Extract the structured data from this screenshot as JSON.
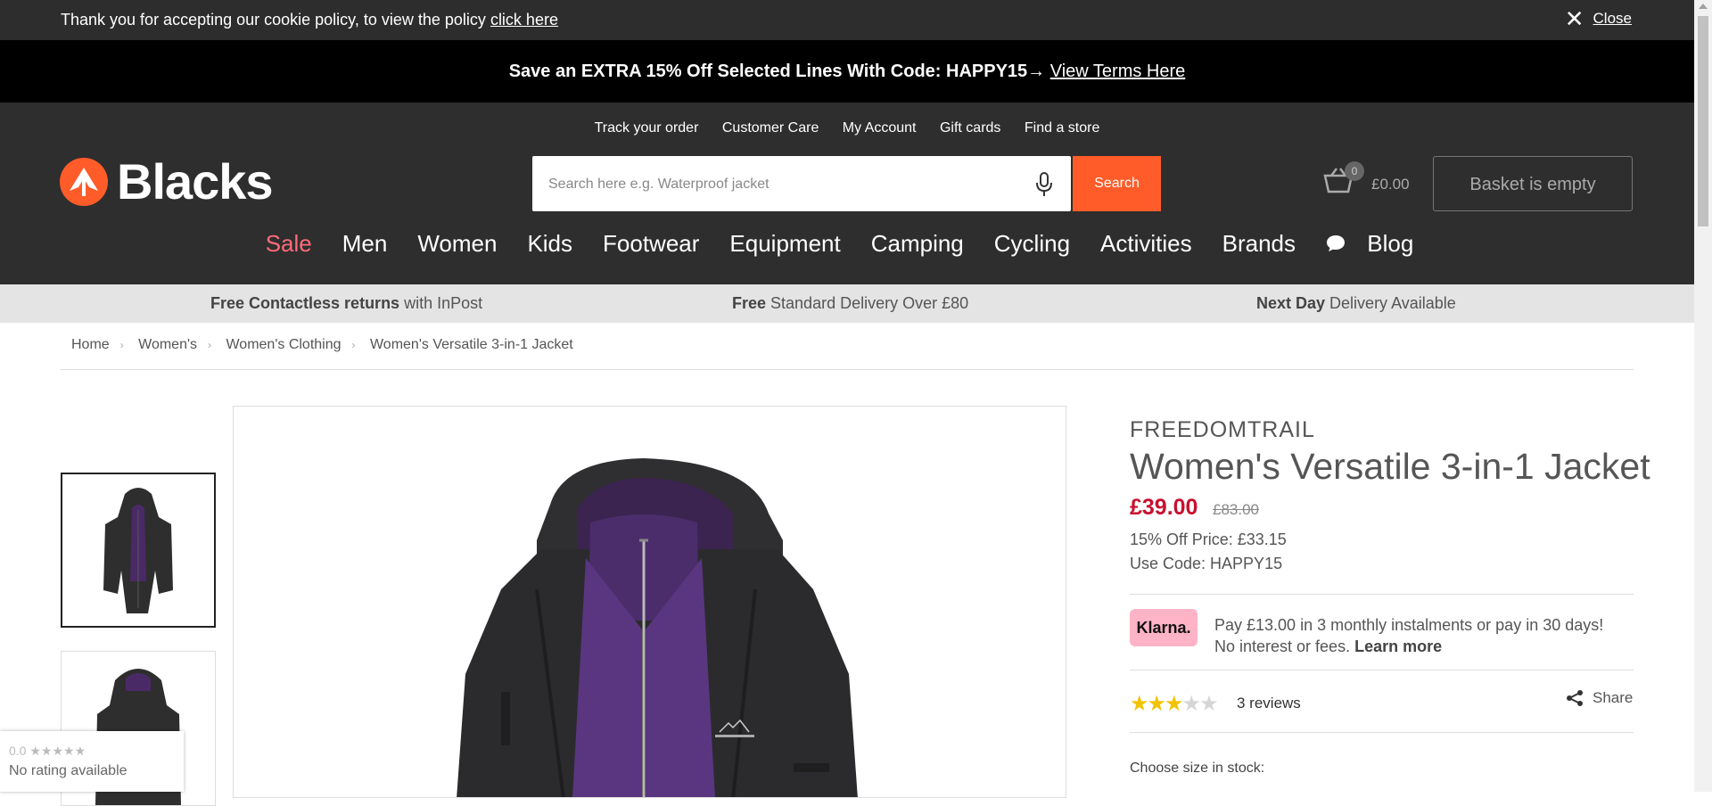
{
  "cookie_bar": {
    "message": "Thank you for accepting our cookie policy, to view the policy",
    "link": "click here",
    "close_icon": "close-x-icon",
    "close_label": "Close"
  },
  "promo_bar": {
    "text": "Save an EXTRA 15% Off Selected Lines With Code: HAPPY15→",
    "link": "View Terms Here"
  },
  "header": {
    "top_links": [
      "Track your order",
      "Customer Care",
      "My Account",
      "Gift cards",
      "Find a store"
    ],
    "logo_text": "Blacks",
    "search_placeholder": "Search here e.g. Waterproof jacket",
    "search_button": "Search",
    "basket_count": "0",
    "basket_total": "£0.00",
    "basket_button": "Basket is empty"
  },
  "main_nav": {
    "items": [
      "Sale",
      "Men",
      "Women",
      "Kids",
      "Footwear",
      "Equipment",
      "Camping",
      "Cycling",
      "Activities",
      "Brands",
      "Blog"
    ]
  },
  "usp_bar": [
    {
      "bold": "Free Contactless returns",
      "rest": " with InPost"
    },
    {
      "bold": "Free",
      "rest": " Standard Delivery Over £80"
    },
    {
      "bold": "Next Day",
      "rest": " Delivery Available"
    }
  ],
  "breadcrumb": [
    "Home",
    "Women's",
    "Women's Clothing",
    "Women's Versatile 3-in-1 Jacket"
  ],
  "product": {
    "brand": "FREEDOMTRAIL",
    "title": "Women's Versatile 3-in-1 Jacket",
    "price": "£39.00",
    "old_price": "£83.00",
    "offer_price": "15% Off Price: £33.15",
    "use_code": "Use Code: HAPPY15",
    "klarna_logo": "Klarna.",
    "klarna_line1": "Pay £13.00 in 3 monthly instalments or pay in 30 days!",
    "klarna_line2": "No interest or fees.",
    "klarna_learn": "Learn more",
    "rating_stars": 3,
    "rating_max": 5,
    "reviews": "3 reviews",
    "share_label": "Share",
    "choose_size": "Choose size in stock:"
  },
  "rating_widget": {
    "score": "0.0",
    "text": "No rating available"
  },
  "colors": {
    "accent": "#ff5c29",
    "sale": "#ff6b7a",
    "price": "#c8102e",
    "header_bg": "#2e2e2e",
    "klarna_pink": "#ffb3c7",
    "star": "#f2c300"
  }
}
